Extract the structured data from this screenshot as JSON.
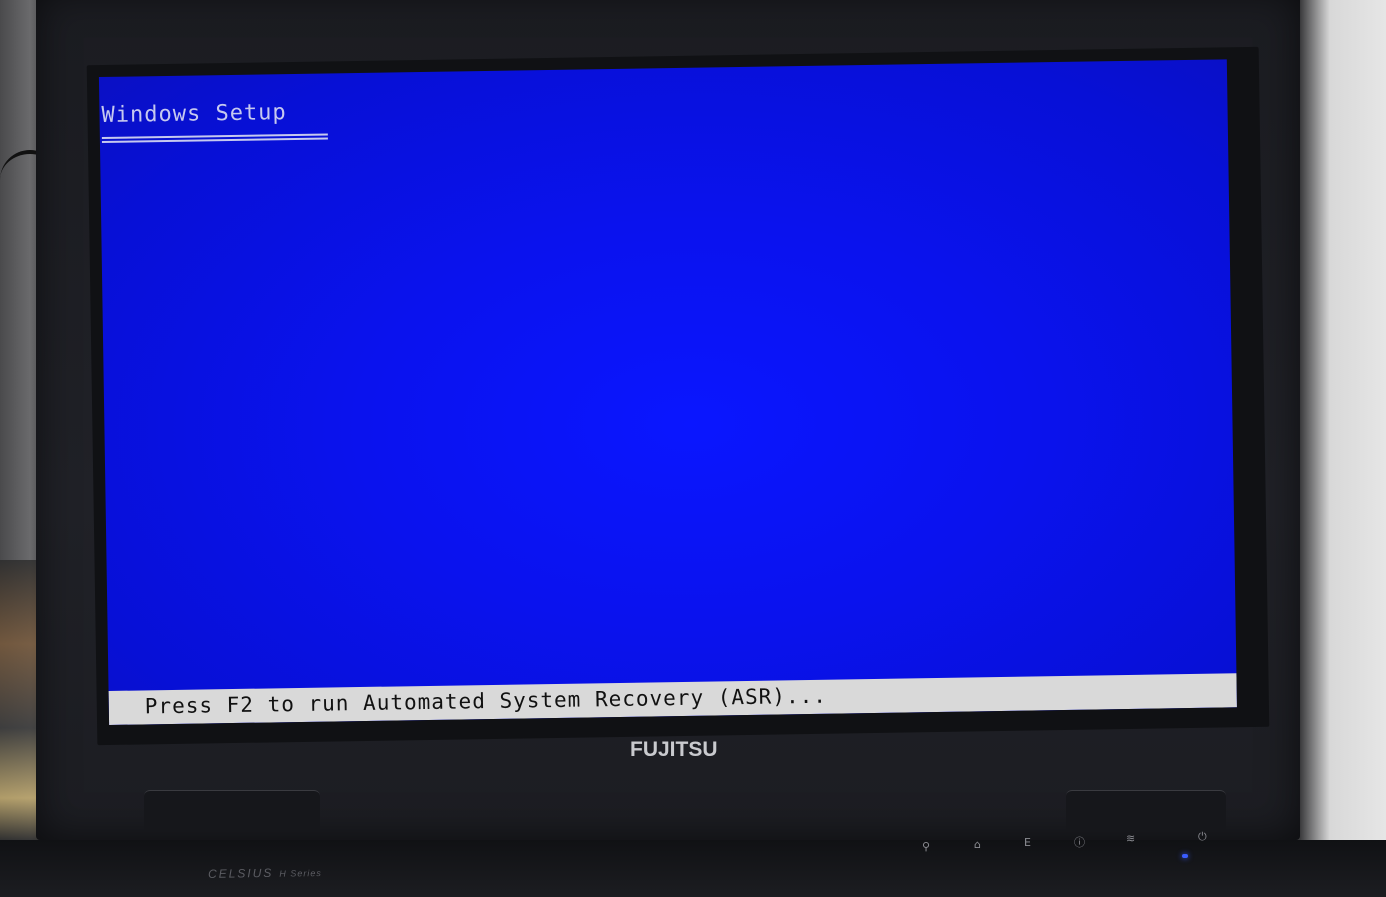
{
  "setup": {
    "title": "Windows Setup",
    "status_message": "Press F2 to run Automated System Recovery (ASR)..."
  },
  "device": {
    "brand": "FUJITSU",
    "model": "CELSIUS",
    "model_series": "H Series",
    "hotkeys": [
      "search-icon",
      "device-icon",
      "E",
      "info-icon",
      "wireless-icon",
      "power-icon"
    ]
  },
  "colors": {
    "screen_blue": "#0a12ee",
    "status_bar": "#d9d9d9",
    "title_text": "#c6c9ef"
  }
}
